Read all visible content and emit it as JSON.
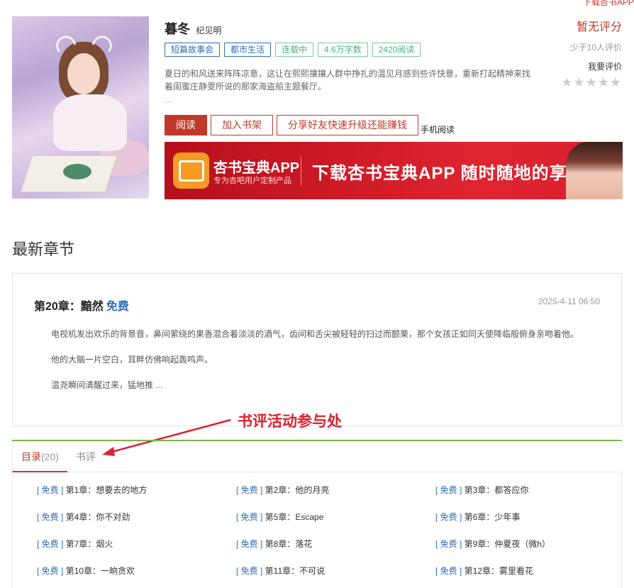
{
  "top_link": "下载杏书APP",
  "book": {
    "title": "暮冬",
    "author": "纪见明",
    "tags": [
      {
        "label": "短篇故事会",
        "style": "blue"
      },
      {
        "label": "都市生活",
        "style": "blue"
      },
      {
        "label": "连载中",
        "style": "green"
      },
      {
        "label": "4.6万字数",
        "style": "green"
      },
      {
        "label": "2420阅读",
        "style": "green"
      }
    ],
    "description": "夏日的和风送来阵阵凉意，这让在熙熙攘攘人群中挣扎的温见月感到些许快意，重新打起精神来找着闺蜜庄静雯所说的那家海盗船主题餐厅。",
    "ellipsis": "..."
  },
  "actions": {
    "read": "阅读",
    "add_shelf": "加入书架",
    "share": "分享好友快速升级还能赚钱",
    "mobile": "手机阅读"
  },
  "rating": {
    "status": "暂无评分",
    "few": "少于10人评价",
    "rate_me": "我要评价",
    "stars": 0,
    "max_stars": 5
  },
  "banner": {
    "app_name": "杏书宝典APP",
    "app_sub": "专为杏吧用户定制产品",
    "slogan": "下载杏书宝典APP 随时随地的享受"
  },
  "latest": {
    "section_title": "最新章节",
    "chapter": "第20章：黯然",
    "free": "免费",
    "time": "2025-4-11 06:50",
    "paragraphs": [
      "电视机发出欢乐的背景音，鼻间萦绕的果香混合着淡淡的酒气，齿间和舌尖被轻轻的扫过而颤栗，那个女孩正如同天使降临般俯身亲吻着他。",
      "他的大脑一片空白，耳畔仿佛响起轰鸣声。",
      "温尧瞬间清醒过来，猛地推 ..."
    ]
  },
  "annotation": "书评活动参与处",
  "tabs": {
    "toc": "目录",
    "toc_count": "(20)",
    "comments": "书评"
  },
  "toc": {
    "free_tag": "[ 免费 ]",
    "chapters": [
      "第1章：想要去的地方",
      "第2章：他的月亮",
      "第3章：都答应你",
      "第4章：你不对劲",
      "第5章：Escape",
      "第6章：少年事",
      "第7章：烟火",
      "第8章：落花",
      "第9章：仲夏夜（微h）",
      "第10章：一晌贪欢",
      "第11章：不可说",
      "第12章：雾里看花"
    ]
  }
}
